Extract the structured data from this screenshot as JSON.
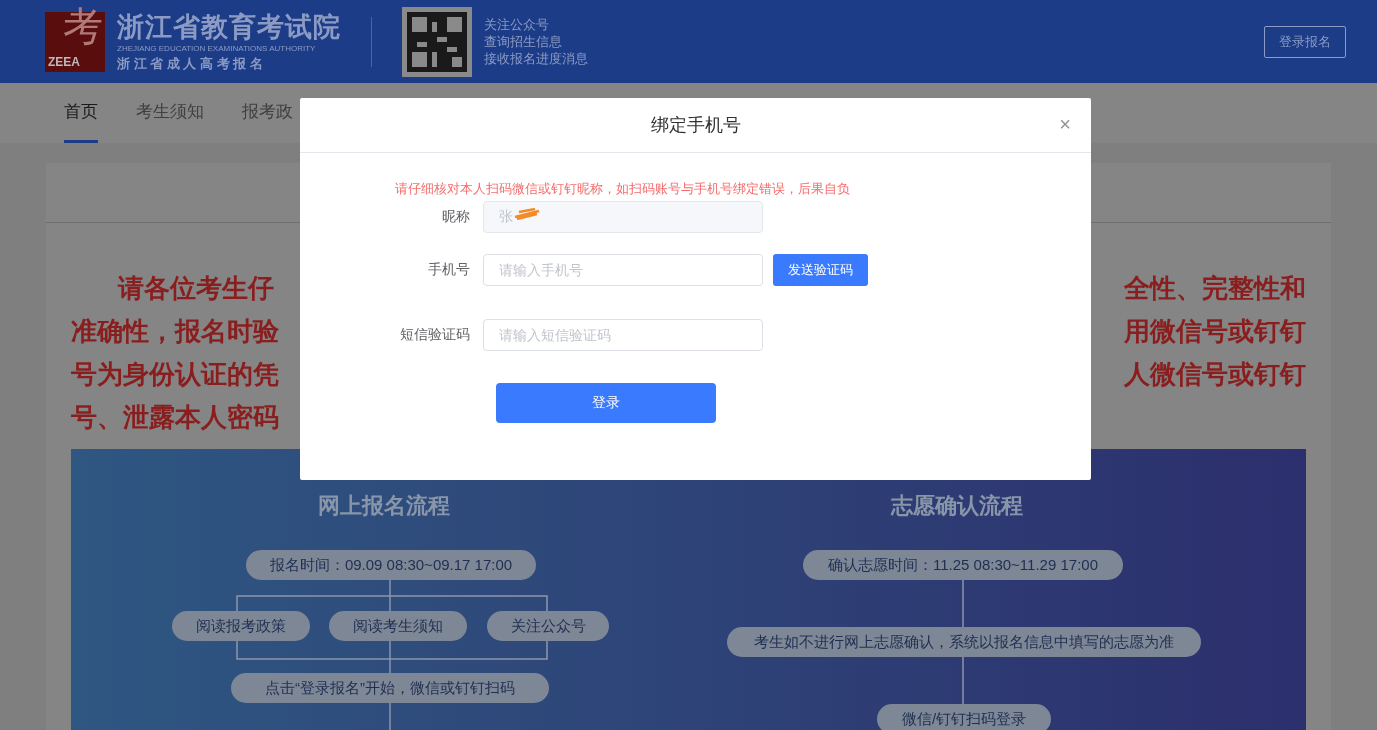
{
  "header": {
    "org_name": "浙江省教育考试院",
    "org_name_en": "ZHEJIANG EDUCATION EXAMINATIONS AUTHORITY",
    "subtitle": "浙 江 省 成 人 高 考 报 名",
    "logo_text": "ZEEA",
    "logo_char": "考",
    "qr_lines": [
      "关注公众号",
      "查询招生信息",
      "接收报名进度消息"
    ],
    "login_button": "登录报名"
  },
  "nav": {
    "tabs": [
      {
        "label": "首页",
        "selected": true
      },
      {
        "label": "考生须知",
        "selected": false
      },
      {
        "label": "报考政",
        "selected": false
      }
    ]
  },
  "notice": {
    "left": [
      "请各位考生仔",
      "准确性，报名时验",
      "号为身份认证的凭",
      "号、泄露本人密码"
    ],
    "right": [
      "全性、完整性和",
      "用微信号或钉钉",
      "人微信号或钉钉"
    ]
  },
  "banner": {
    "left_title": "网上报名流程",
    "left_steps": {
      "time": "报名时间：09.09 08:30~09.17 17:00",
      "options": [
        "阅读报考政策",
        "阅读考生须知",
        "关注公众号"
      ],
      "start": "点击“登录报名”开始，微信或钉钉扫码"
    },
    "right_title": "志愿确认流程",
    "right_steps": [
      "确认志愿时间：11.25 08:30~11.29 17:00",
      "考生如不进行网上志愿确认，系统以报名信息中填写的志愿为准",
      "微信/钉钉扫码登录"
    ]
  },
  "dialog": {
    "title": "绑定手机号",
    "close": "×",
    "warning": "请仔细核对本人扫码微信或钉钉昵称，如扫码账号与手机号绑定错误，后果自负",
    "fields": [
      {
        "label": "昵称",
        "kind": "readonly",
        "value": "张",
        "redacted": true
      },
      {
        "label": "手机号",
        "kind": "input",
        "placeholder": "请输入手机号",
        "action": "发送验证码"
      },
      {
        "label": "短信验证码",
        "kind": "input",
        "placeholder": "请输入短信验证码"
      }
    ],
    "submit": "登录"
  }
}
